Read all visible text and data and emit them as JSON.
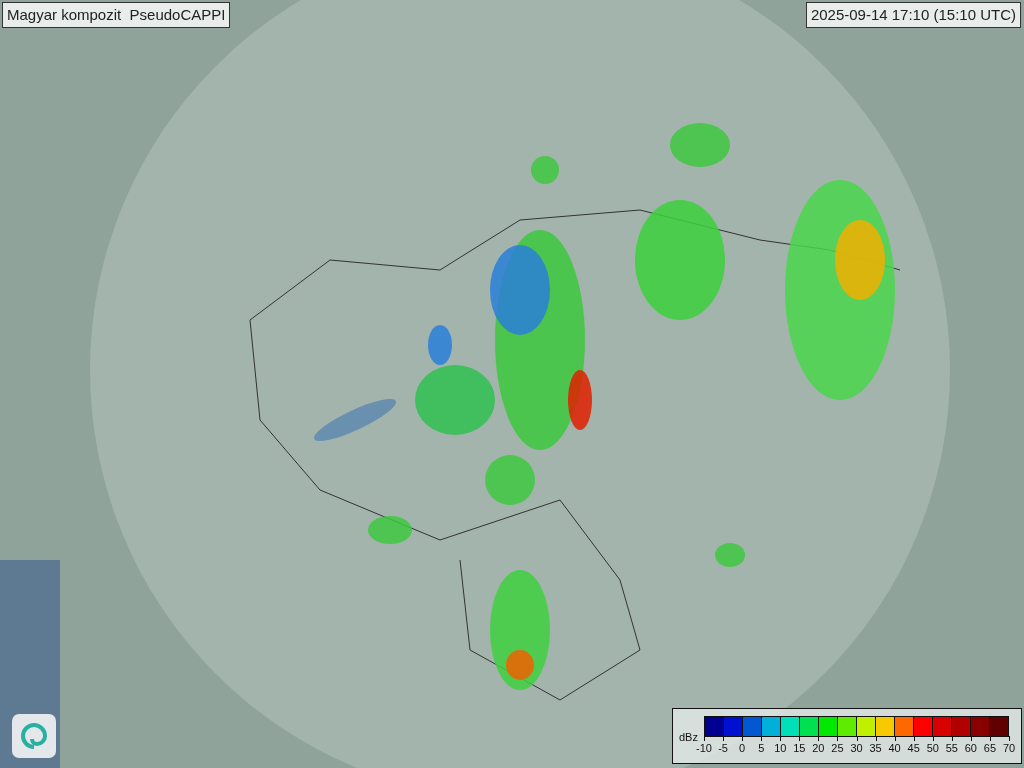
{
  "title": "Magyar kompozit  PseudoCAPPI",
  "timestamp": "2025-09-14 17:10 (15:10 UTC)",
  "legend": {
    "unit": "dBz",
    "bins": [
      {
        "color": "#000090"
      },
      {
        "color": "#0010d0"
      },
      {
        "color": "#0058d0"
      },
      {
        "color": "#00b0d8"
      },
      {
        "color": "#00e0b8"
      },
      {
        "color": "#00e050"
      },
      {
        "color": "#00e800"
      },
      {
        "color": "#60ec00"
      },
      {
        "color": "#c0f000"
      },
      {
        "color": "#f8c800"
      },
      {
        "color": "#ff6800"
      },
      {
        "color": "#ff0000"
      },
      {
        "color": "#d80000"
      },
      {
        "color": "#b00000"
      },
      {
        "color": "#880000"
      },
      {
        "color": "#600000"
      }
    ],
    "ticks": [
      "-10",
      "-5",
      "0",
      "5",
      "10",
      "15",
      "20",
      "25",
      "30",
      "35",
      "40",
      "45",
      "50",
      "55",
      "60",
      "65",
      "70"
    ]
  }
}
